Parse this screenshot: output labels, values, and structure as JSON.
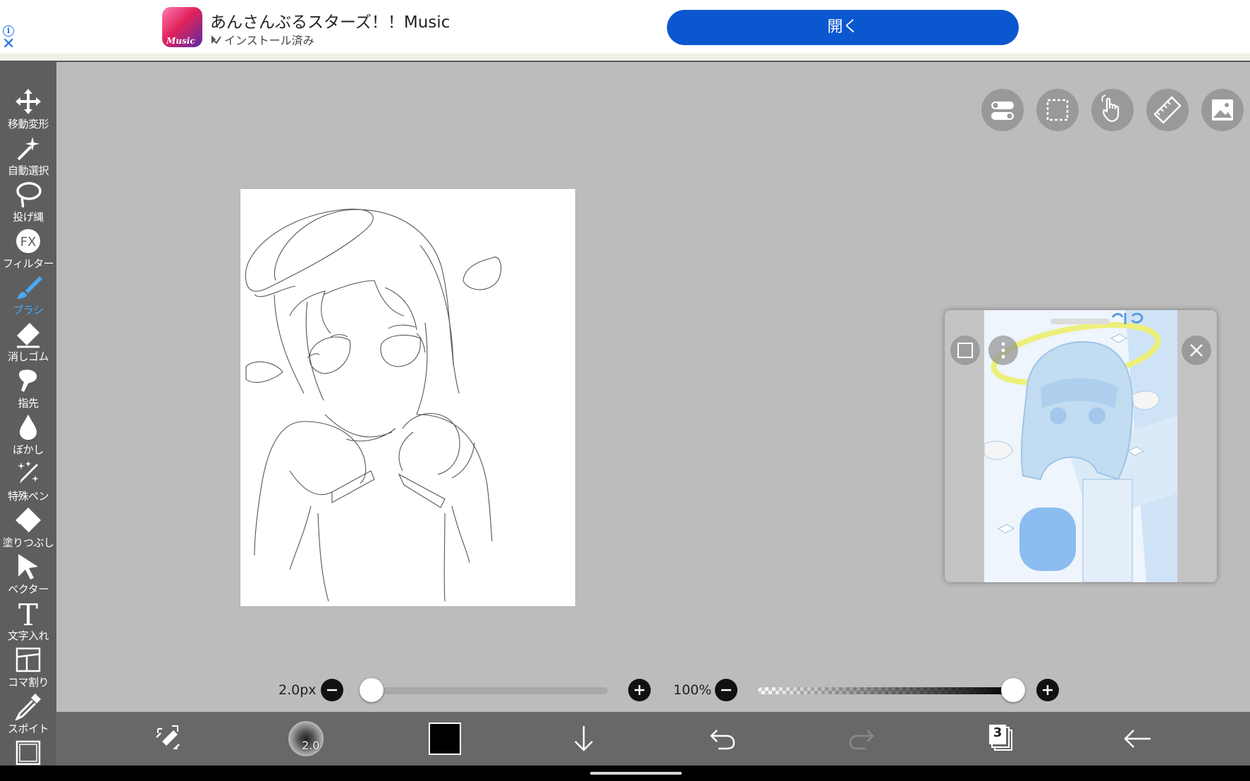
{
  "ad": {
    "title": "あんさんぶるスターズ！！Music",
    "subtitle": "インストール済み",
    "icon_text": "Music",
    "open_button": "開く",
    "info_icon": "info-icon",
    "close_icon": "close-icon",
    "button_color": "#0b57d0"
  },
  "tools": [
    {
      "label": "移動変形",
      "icon": "move-transform-icon"
    },
    {
      "label": "自動選択",
      "icon": "magic-wand-icon"
    },
    {
      "label": "投げ縄",
      "icon": "lasso-icon"
    },
    {
      "label": "フィルター",
      "icon": "fx-filter-icon"
    },
    {
      "label": "ブラシ",
      "icon": "brush-icon",
      "active": true
    },
    {
      "label": "消しゴム",
      "icon": "eraser-icon"
    },
    {
      "label": "指先",
      "icon": "finger-smudge-icon"
    },
    {
      "label": "ぼかし",
      "icon": "blur-drop-icon"
    },
    {
      "label": "特殊ペン",
      "icon": "special-pen-icon"
    },
    {
      "label": "塗りつぶし",
      "icon": "fill-bucket-icon"
    },
    {
      "label": "ベクター",
      "icon": "vector-arrow-icon"
    },
    {
      "label": "文字入れ",
      "icon": "text-icon"
    },
    {
      "label": "コマ割り",
      "icon": "panel-divide-icon"
    },
    {
      "label": "スポイト",
      "icon": "eyedropper-icon"
    }
  ],
  "active_color": "#4aa8f2",
  "fx_text": "FX",
  "text_tool_glyph": "T",
  "brush": {
    "size_label": "2.0px",
    "size_value": 2.0,
    "opacity_label": "100%",
    "opacity_value": 1.0,
    "indicator_text": "2.0"
  },
  "layers": {
    "count": "3"
  },
  "top_buttons": [
    "toggle-icon",
    "selection-icon",
    "hand-icon",
    "ruler-icon",
    "image-icon"
  ],
  "bottom_buttons": [
    "transform-tool-icon",
    "brush-preview",
    "color-swatch",
    "download-icon",
    "undo-icon",
    "redo-icon",
    "layers-icon",
    "back-icon"
  ],
  "current_color": "#000000"
}
